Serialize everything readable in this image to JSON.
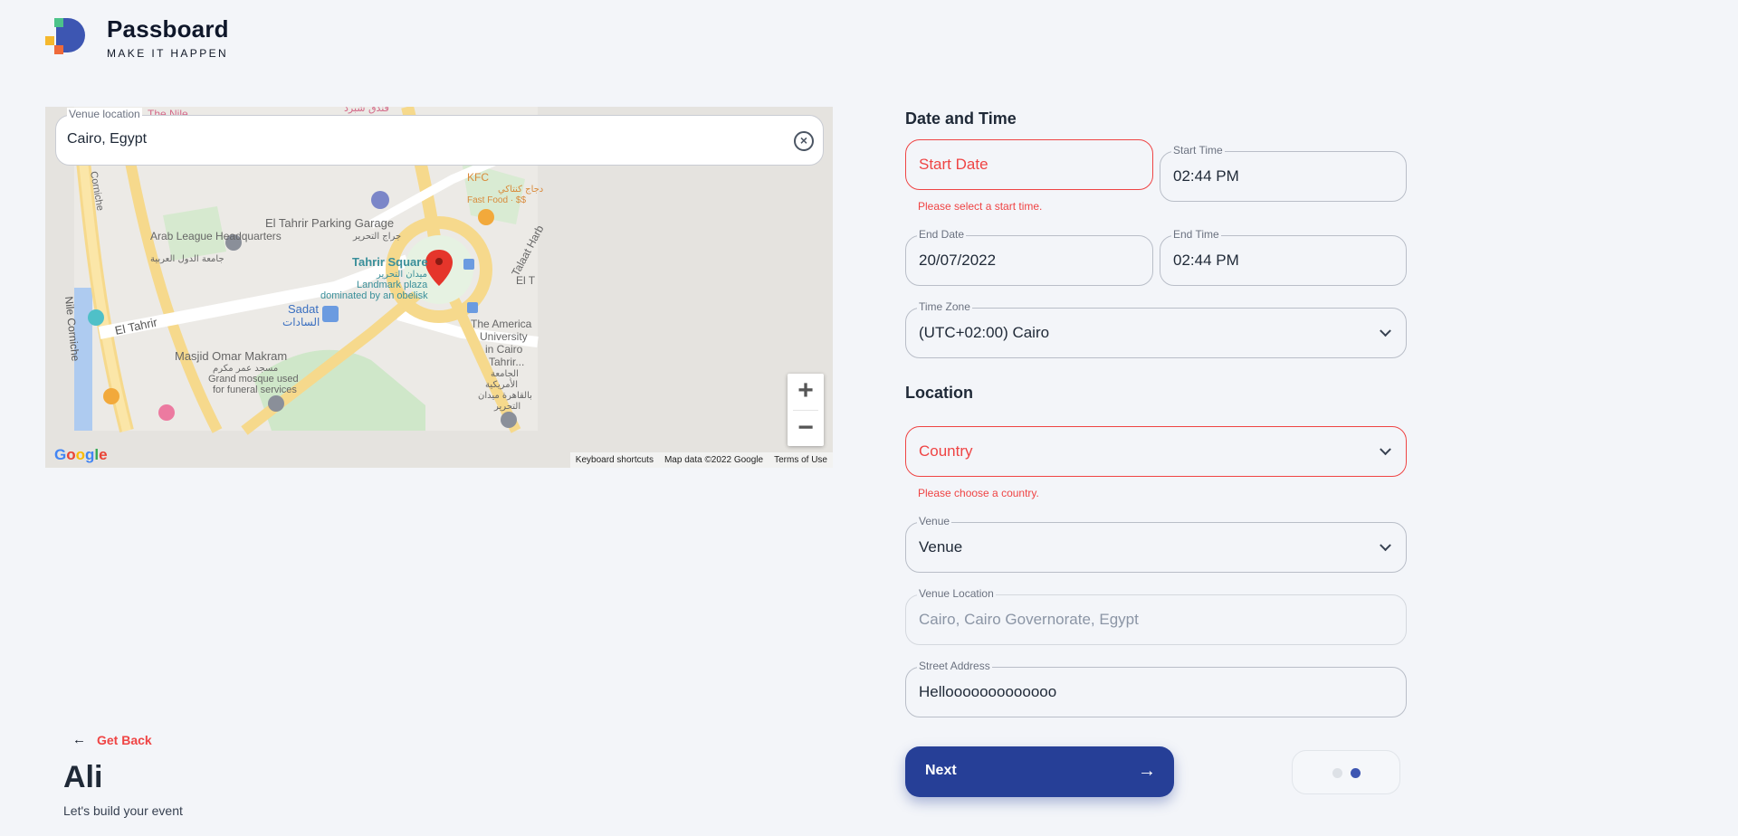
{
  "brand": {
    "name": "Passboard",
    "tagline": "MAKE IT HAPPEN"
  },
  "map": {
    "search_label": "Venue location",
    "search_value": "Cairo, Egypt",
    "labels": {
      "nile": "The Nile",
      "cornice_top": "Corniche",
      "nile_cornice": "Nile Corniche",
      "arab_league": "Arab League Headquarters",
      "arab_league_ar": "جامعة الدول العربية",
      "parking": "El Tahrir Parking Garage",
      "parking_ar": "جراج التحرير",
      "kfc": "KFC",
      "kfc_ar": "دجاج كنتاكي",
      "kfc_sub": "Fast Food · $$",
      "tahrir": "Tahrir Square",
      "tahrir_ar": "ميدان التحرير",
      "tahrir_sub1": "Landmark plaza",
      "tahrir_sub2": "dominated by an obelisk",
      "talaat": "Talaat Harb",
      "el_t": "El T",
      "sadat": "Sadat",
      "sadat_ar": "السادات",
      "el_tahrir": "El Tahrir",
      "omar": "Masjid Omar Makram",
      "omar_ar": "مسجد عمر مكرم",
      "omar_sub1": "Grand mosque used",
      "omar_sub2": "for funeral services",
      "auc1": "The America",
      "auc2": "University",
      "auc3": "in Cairo",
      "auc4": "Tahrir...",
      "auc_ar1": "الجامعة",
      "auc_ar2": "الأمريكية",
      "auc_ar3": "بالقاهرة ميدان",
      "auc_ar4": "التحرير",
      "top_ar": "فندق شبرد"
    },
    "google": "Google",
    "attribution": [
      "Keyboard shortcuts",
      "Map data ©2022 Google",
      "Terms of Use"
    ],
    "zoom_in": "+",
    "zoom_out": "−"
  },
  "form": {
    "date_time_title": "Date and Time",
    "start_date": {
      "placeholder": "Start Date",
      "error": "Please select a start time."
    },
    "start_time": {
      "label": "Start Time",
      "value": "02:44 PM"
    },
    "end_date": {
      "label": "End Date",
      "value": "20/07/2022"
    },
    "end_time": {
      "label": "End Time",
      "value": "02:44 PM"
    },
    "time_zone": {
      "label": "Time Zone",
      "value": "(UTC+02:00) Cairo"
    },
    "location_title": "Location",
    "country": {
      "placeholder": "Country",
      "error": "Please choose a country."
    },
    "venue": {
      "label": "Venue",
      "value": "Venue"
    },
    "venue_location": {
      "label": "Venue Location",
      "value": "Cairo, Cairo Governorate, Egypt"
    },
    "street_address": {
      "label": "Street Address",
      "value": "Hellooooooooooooo"
    },
    "next_label": "Next",
    "next_arrow": "→"
  },
  "stepper": {
    "total": 2,
    "current": 2
  },
  "sidebar": {
    "back_icon": "←",
    "back_label": "Get Back",
    "user_name": "Ali",
    "subtitle": "Let's build your event"
  },
  "colors": {
    "accent": "#263f97",
    "error": "#ef4444",
    "background": "#f3f5f9"
  }
}
